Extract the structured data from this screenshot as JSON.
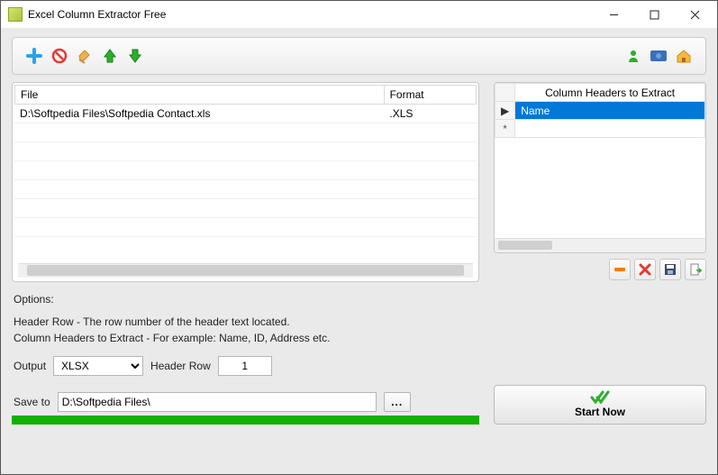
{
  "app": {
    "title": "Excel Column Extractor Free"
  },
  "files": {
    "columns": [
      "File",
      "Format"
    ],
    "rows": [
      {
        "path": "D:\\Softpedia Files\\Softpedia Contact.xls",
        "format": ".XLS"
      }
    ]
  },
  "headers": {
    "title": "Column Headers to Extract",
    "rows": [
      "Name"
    ]
  },
  "options": {
    "label": "Options:",
    "line1": "Header Row - The row number of the header text located.",
    "line2": "Column Headers to Extract - For example: Name, ID, Address etc.",
    "output_label": "Output",
    "output_value": "XLSX",
    "header_row_label": "Header Row",
    "header_row_value": "1",
    "save_label": "Save to",
    "save_value": "D:\\Softpedia Files\\",
    "browse": "..."
  },
  "start": {
    "label": "Start Now"
  }
}
